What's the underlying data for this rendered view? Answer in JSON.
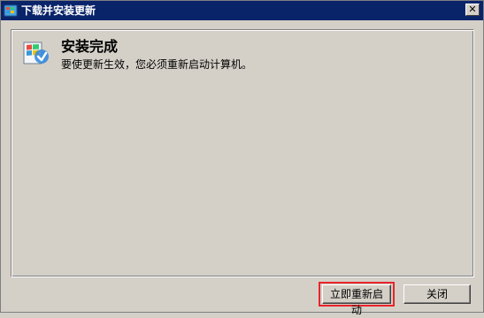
{
  "window": {
    "title": "下载并安装更新",
    "close_glyph": "✕"
  },
  "status": {
    "heading": "安装完成",
    "message": "要使更新生效，您必须重新启动计算机。",
    "icon": "windows-update-icon"
  },
  "buttons": {
    "restart_label": "立即重新启动",
    "close_label": "关闭"
  },
  "colors": {
    "titlebar": "#0a246a",
    "highlight_frame": "#e8242a",
    "face": "#d4d0c8"
  }
}
